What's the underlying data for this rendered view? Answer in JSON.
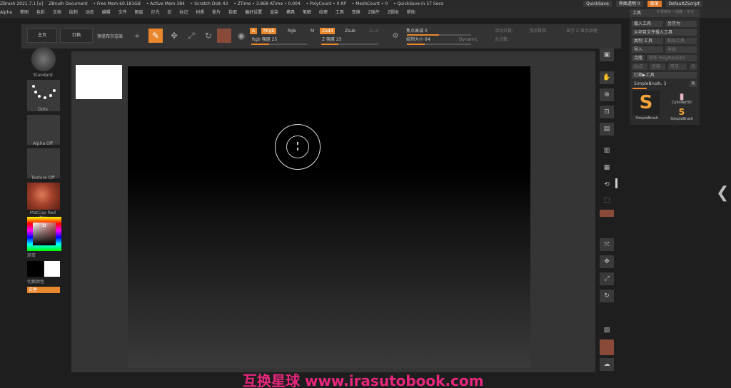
{
  "titlebar": {
    "items": [
      "ZBrush 2021.7.1 [x]",
      "ZBrush Document",
      "• Free Mem 60.181GB",
      "• Active Mem 384",
      "• Scratch Disk 43",
      "• ZTime • 3.868 ATime • 0.004",
      "• PolyCount • 0 KP",
      "• MeshCount • 0",
      "• QuickSave in 57 Secs"
    ]
  },
  "topright": {
    "label1": "QuickSave",
    "label2": "界面透明 0",
    "label3": "菜单",
    "label4": "DefaultZScript"
  },
  "menubar": {
    "items": [
      "Alpha",
      "笔刷",
      "色彩",
      "文档",
      "绘制",
      "动态",
      "编辑",
      "文件",
      "图层",
      "灯光",
      "宏",
      "标记",
      "材质",
      "影片",
      "拾取",
      "偏好设置",
      "渲染",
      "模具",
      "笔触",
      "纹理",
      "工具",
      "变换",
      "Z插件",
      "Z脚本",
      "帮助"
    ]
  },
  "toolbar": {
    "btn1": "主页",
    "btn2": "灯箱",
    "btn3": "预览布尔渲染",
    "mrgb": "Mrgb",
    "rgb": "Rgb",
    "m": "M",
    "zadd": "Zadd",
    "zsub": "Zsub",
    "a": "A",
    "zcut": "Zcut",
    "rgb_intensity": "Rgb 强度 25",
    "z_intensity": "Z 强度 25",
    "focal_shift": "焦点衰减 0",
    "draw_size": "绘制大小 64",
    "dynamic": "Dynamic",
    "active_points": "活动点数:",
    "total_points": "总点数:",
    "label_a": "顶点数目:",
    "label_b": "显示 Z 显示纹理"
  },
  "leftshelf": {
    "standard": "Standard",
    "dots": "Dots",
    "alpha": "Alpha Off",
    "texture": "Texture Off",
    "material": "MatCap Red Wax",
    "gradient": "渐变",
    "switch_color": "切换颜色",
    "alternate": "交替"
  },
  "rightshelf": {
    "items": [
      "立体渲染",
      "透视",
      "地面",
      "局部",
      "对称",
      "框架",
      "移动",
      "缩放",
      "旋转",
      "线框",
      "透明",
      "单独"
    ]
  },
  "toolpanel": {
    "title": "工具",
    "header_right": "扩展菜单 • 隐藏 • 定位",
    "load_tool": "载入工具",
    "save_as": "另存为",
    "copy_from": "从项目文件载入工具",
    "copy_tool": "复制 工具",
    "paste": "粘贴工具",
    "import": "导入",
    "export": "导出",
    "clone": "克隆",
    "make_polymesh": "制作 PolyMesh3D",
    "goz": "GoZ",
    "all": "全部",
    "visible": "可见",
    "r": "R",
    "lightbox_tools": "灯箱▶工具",
    "current_tool": "SimpleBrush. 3",
    "r2": "R",
    "tool1": "SimpleBrush",
    "tool2": "Cylinder3D",
    "tool3": "SimpleBrush"
  },
  "watermark": "互换星球 www.irasutobook.com"
}
